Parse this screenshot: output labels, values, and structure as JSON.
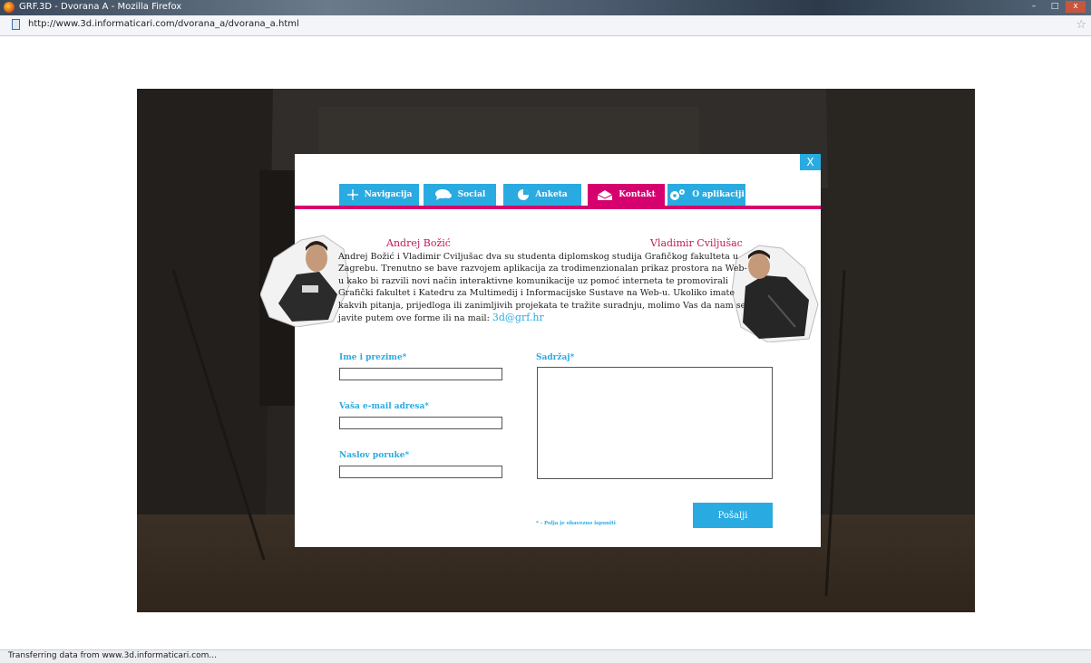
{
  "browser": {
    "window_title": "GRF.3D - Dvorana A - Mozilla Firefox",
    "url": "http://www.3d.informaticari.com/dvorana_a/dvorana_a.html",
    "status_text": "Transferring data from www.3d.informaticari.com...",
    "controls": {
      "minimize": "–",
      "maximize": "□",
      "close": "x"
    }
  },
  "modal": {
    "close_label": "X",
    "tabs": [
      {
        "label": "Navigacija",
        "icon": "navigation-icon"
      },
      {
        "label": "Social",
        "icon": "speech-bubble-icon"
      },
      {
        "label": "Anketa",
        "icon": "pie-chart-icon"
      },
      {
        "label": "Kontakt",
        "icon": "envelope-icon",
        "active": true
      },
      {
        "label": "O aplikaciji",
        "icon": "gears-icon"
      }
    ],
    "authors": {
      "left": "Andrej Božić",
      "right": "Vladimir Cviljušac"
    },
    "intro_text": "Andrej Božić  i Vladimir Cviljušac dva su studenta diplomskog studija Grafičkog fakulteta u Zagrebu. Trenutno se bave razvojem aplikacija za trodimenzionalan prikaz prostora na Web-u kako bi razvili novi način interaktivne komunikacije uz pomoć interneta te promovirali Grafički fakultet i Katedru za Multimedij i Informacijske Sustave na Web-u. Ukoliko imate kakvih pitanja, prijedloga ili zanimljivih projekata te tražite suradnju, molimo Vas da nam se javite putem ove forme ili na mail: ",
    "email": "3d@grf.hr",
    "form": {
      "name_label": "Ime i prezime*",
      "name_value": "",
      "email_label": "Vaša e-mail adresa*",
      "email_value": "",
      "subject_label": "Naslov poruke*",
      "subject_value": "",
      "content_label": "Sadržaj*",
      "content_value": "",
      "required_note": "* - Polja je obavezno ispuniti",
      "submit_label": "Pošalji"
    }
  },
  "colors": {
    "accent_blue": "#29abe2",
    "accent_magenta": "#d6006e"
  }
}
